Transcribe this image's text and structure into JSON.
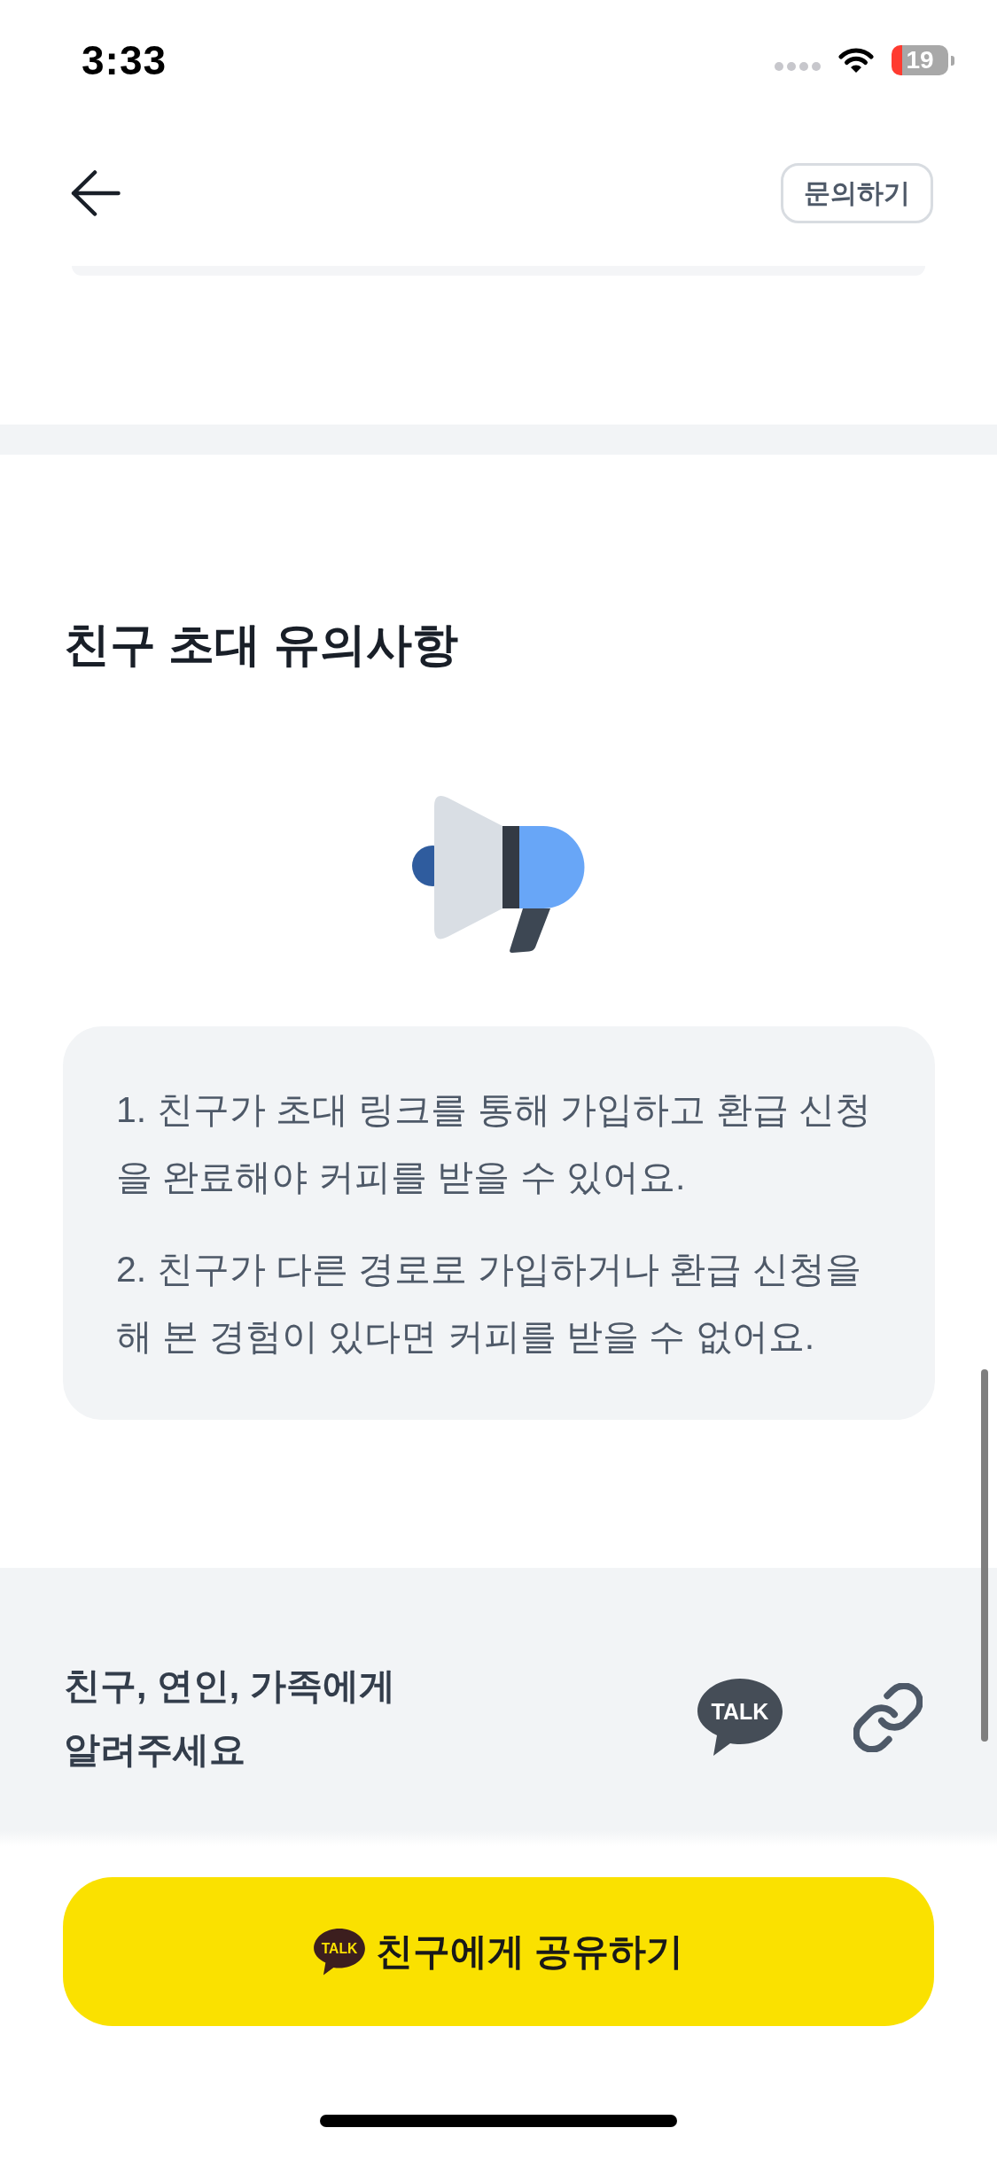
{
  "status_bar": {
    "time": "3:33",
    "battery": "19"
  },
  "header": {
    "help_button": "문의하기"
  },
  "notice": {
    "title": "친구 초대 유의사항",
    "items": [
      "1. 친구가 초대 링크를 통해 가입하고 환급 신청을 완료해야 커피를 받을 수 있어요.",
      "2. 친구가 다른 경로로 가입하거나 환급 신청을 해 본 경험이 있다면 커피를 받을 수 없어요."
    ]
  },
  "share": {
    "prompt": "친구, 연인, 가족에게 알려주세요",
    "options": [
      {
        "kind": "talk",
        "label": "TALK"
      },
      {
        "kind": "link"
      }
    ]
  },
  "cta": {
    "icon_label": "TALK",
    "label": "친구에게 공유하기"
  }
}
